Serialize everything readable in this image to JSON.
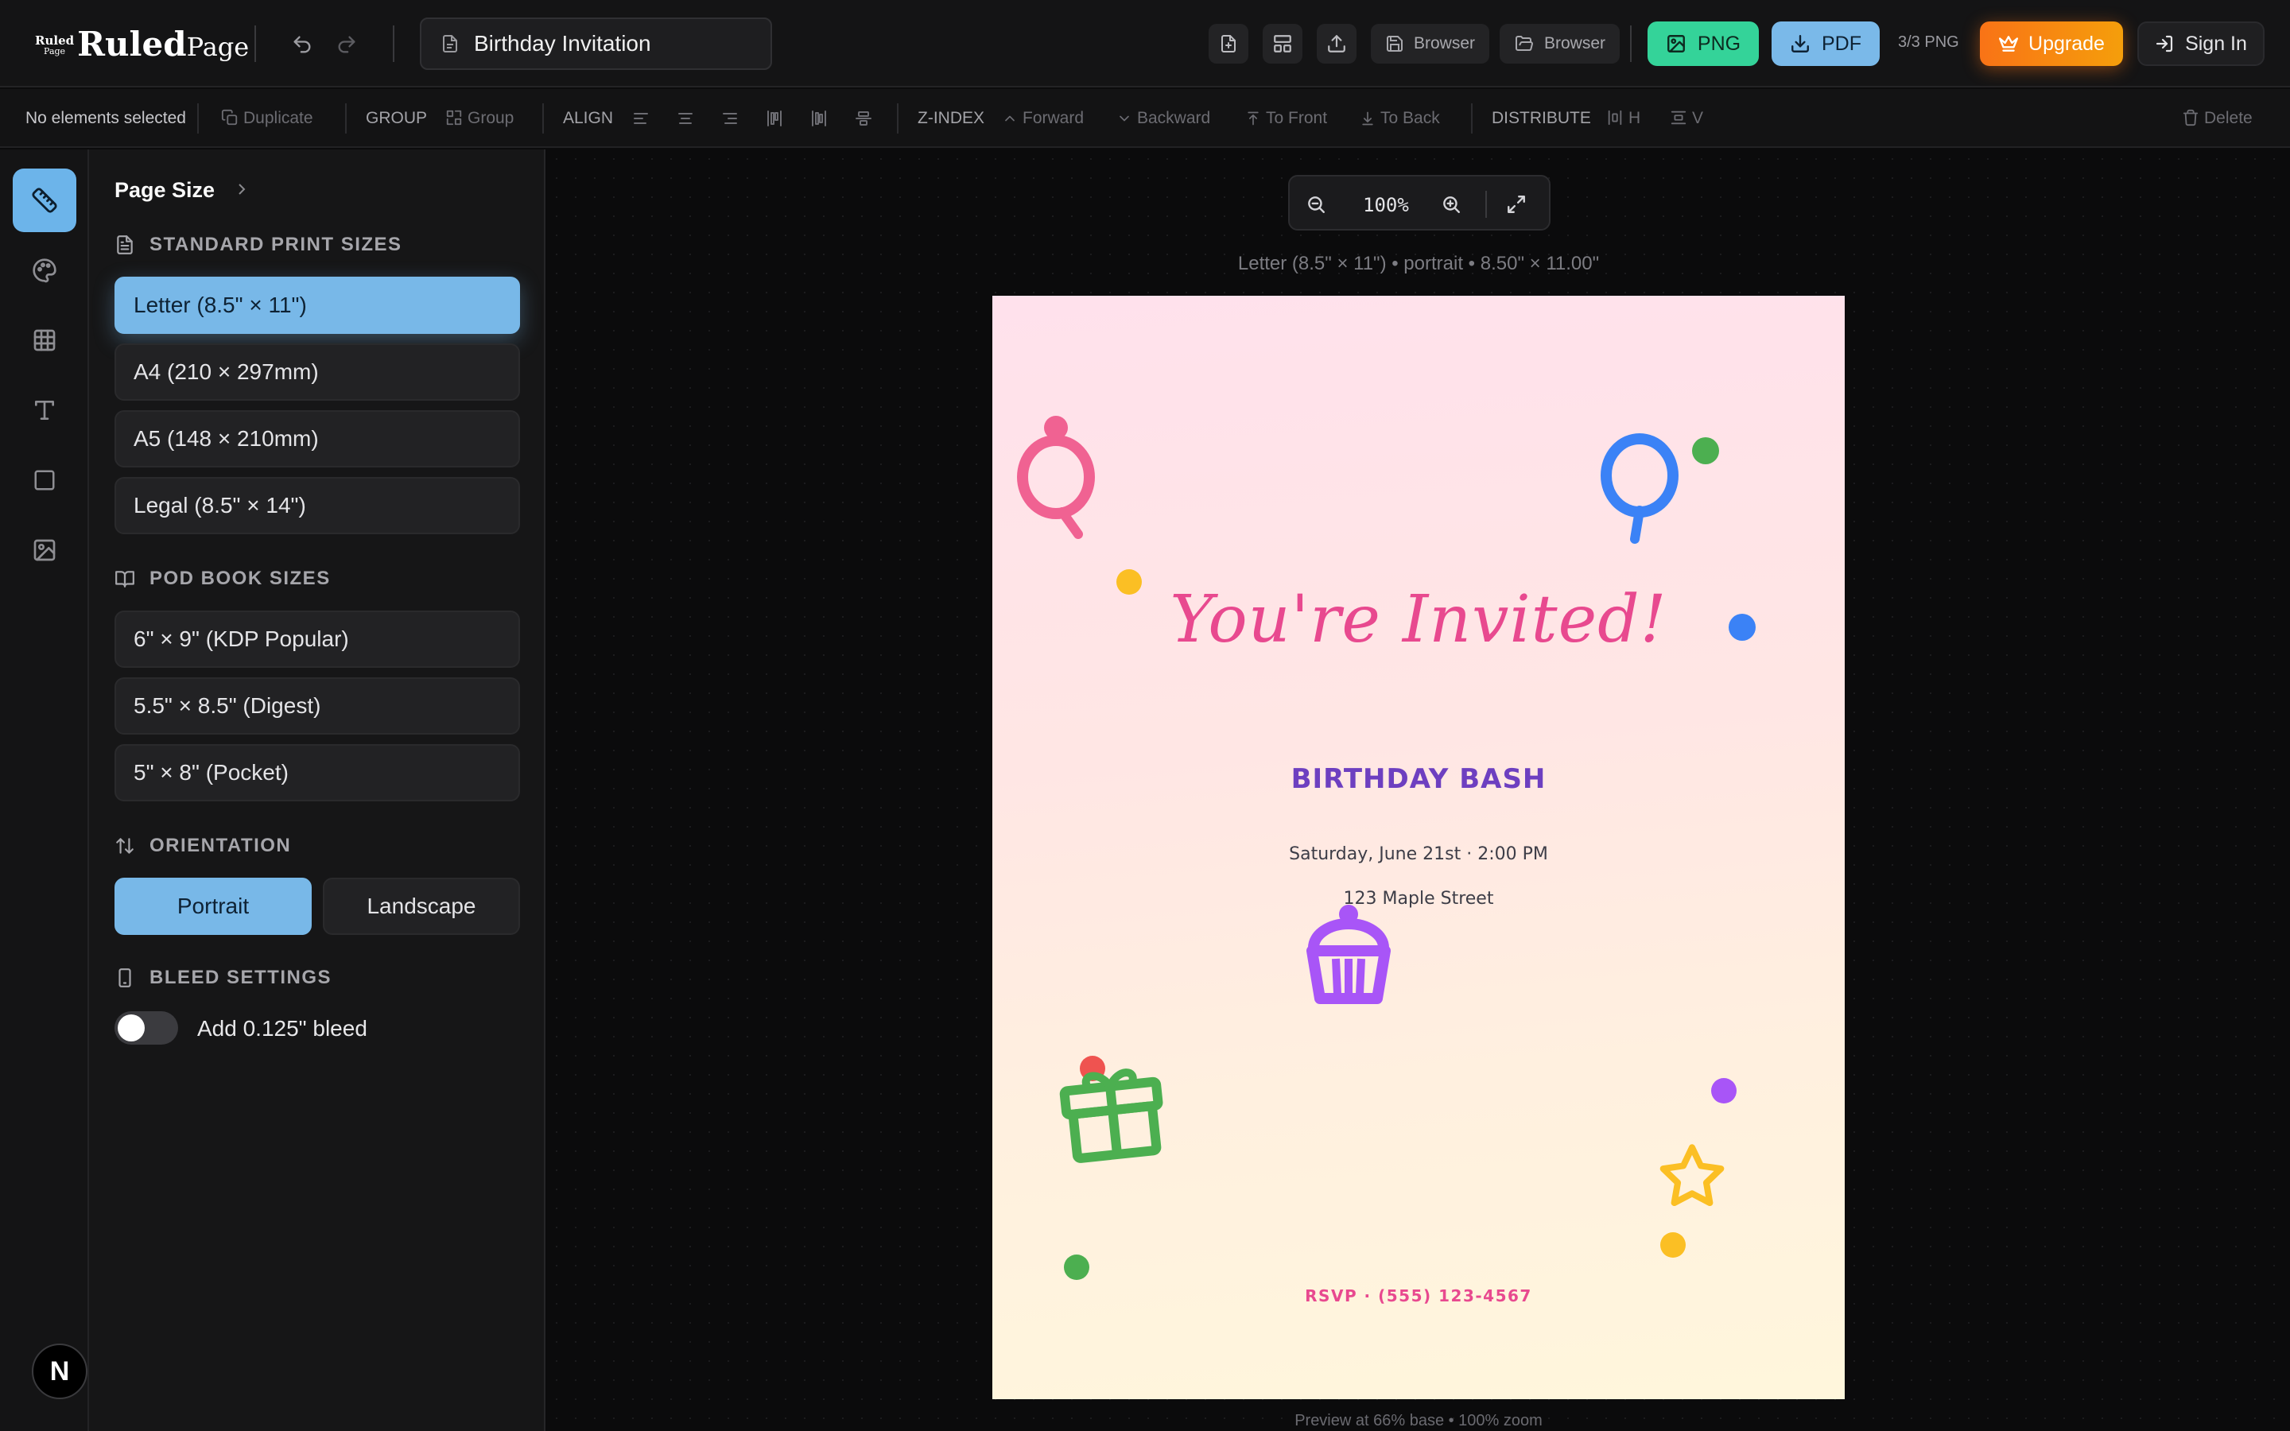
{
  "app": {
    "logo_small_top": "Ruled",
    "logo_small_bottom": "Page",
    "logo_big": "Ruled",
    "logo_page": "Page",
    "document_name": "Birthday Invitation"
  },
  "topbar": {
    "save_browser_label": "Browser",
    "open_browser_label": "Browser",
    "png_label": "PNG",
    "pdf_label": "PDF",
    "quota": "3/3 PNG",
    "upgrade_label": "Upgrade",
    "signin_label": "Sign In",
    "colors": {
      "png": "#34d399",
      "pdf": "#7ab9e9",
      "upgrade": "#f97316"
    }
  },
  "toolbar": {
    "selection_status": "No elements selected",
    "duplicate": "Duplicate",
    "group_section": "GROUP",
    "group": "Group",
    "align_section": "ALIGN",
    "zindex_section": "Z-INDEX",
    "forward": "Forward",
    "backward": "Backward",
    "to_front": "To Front",
    "to_back": "To Back",
    "distribute_section": "DISTRIBUTE",
    "dist_h": "H",
    "dist_v": "V",
    "delete": "Delete"
  },
  "rail": {
    "items": [
      "ruler-icon",
      "palette-icon",
      "grid-icon",
      "text-icon",
      "square-icon",
      "image-icon"
    ],
    "active": "ruler-icon",
    "badge": "N"
  },
  "panel": {
    "title": "Page Size",
    "standard_heading": "STANDARD PRINT SIZES",
    "standard_sizes": [
      "Letter (8.5\" × 11\")",
      "A4 (210 × 297mm)",
      "A5 (148 × 210mm)",
      "Legal (8.5\" × 14\")"
    ],
    "selected_size": "Letter (8.5\" × 11\")",
    "pod_heading": "POD BOOK SIZES",
    "pod_sizes": [
      "6\" × 9\" (KDP Popular)",
      "5.5\" × 8.5\" (Digest)",
      "5\" × 8\" (Pocket)"
    ],
    "orientation_heading": "ORIENTATION",
    "orientation_portrait": "Portrait",
    "orientation_landscape": "Landscape",
    "orientation_selected": "Portrait",
    "bleed_heading": "BLEED SETTINGS",
    "bleed_label": "Add 0.125\" bleed",
    "bleed_enabled": false,
    "accent_color": "#78b8e8"
  },
  "canvas": {
    "zoom": "100%",
    "page_info": "Letter (8.5\" × 11\") • portrait • 8.50\" × 11.00\"",
    "footnote": "Preview at 66% base • 100% zoom"
  },
  "invitation": {
    "title": "You're Invited!",
    "event": "BIRTHDAY BASH",
    "date": "Saturday, June 21st  ·  2:00 PM",
    "address": "123 Maple Street",
    "rsvp": "RSVP · (555) 123-4567",
    "colors": {
      "title": "#e8498f",
      "event": "#6d3fc0",
      "body": "#3d3d47"
    },
    "decorations": [
      "pink-balloon-icon",
      "blue-balloon-icon",
      "cupcake-icon",
      "gift-icon",
      "star-icon"
    ]
  }
}
